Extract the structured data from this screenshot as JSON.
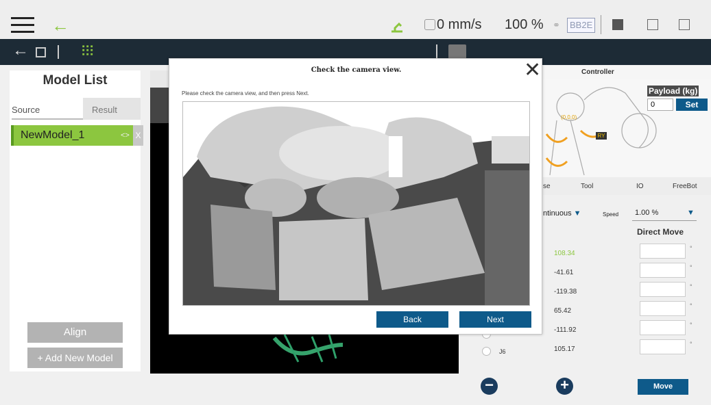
{
  "topbar": {
    "speed": "0 mm/s",
    "percent": "100 %",
    "robot_id": "BB2E"
  },
  "left": {
    "title": "Model List",
    "tab_source": "Source",
    "tab_result": "Result",
    "model_item": "NewModel_1",
    "chevron": "<>",
    "close": "X",
    "align_button": "Align",
    "add_model_button": "+ Add New Model"
  },
  "modal": {
    "title": "Check the camera view.",
    "instruction": "Please check the camera view, and then press Next.",
    "back_label": "Back",
    "next_label": "Next"
  },
  "right": {
    "controller_label": "Controller",
    "payload_label": "Payload (kg)",
    "payload_value": "0",
    "set_label": "Set",
    "tabs": [
      "se",
      "Tool",
      "IO",
      "FreeBot"
    ],
    "mode_value": "ntinuous",
    "speed_label": "Speed",
    "speed_value": "1.00 %",
    "direct_move": "Direct Move",
    "joint_values": [
      "108.34",
      "-41.61",
      "-119.38",
      "65.42",
      "-111.92",
      "105.17"
    ],
    "joint_label_j6": "J6",
    "move_label": "Move",
    "ry_label": "RY",
    "origin_label": "(0,0,0)"
  },
  "colors": {
    "accent_green": "#8cc63f",
    "nav_dark": "#1d2b36",
    "button_blue": "#0e5a8a"
  },
  "icons": [
    "menu-icon",
    "back-arrow-icon",
    "robot-icon",
    "speed-icon",
    "link-icon",
    "calculator-icon",
    "info-icon",
    "document-icon",
    "save-icon",
    "sliders-icon",
    "book-icon",
    "close-icon",
    "minus-icon",
    "plus-icon"
  ]
}
